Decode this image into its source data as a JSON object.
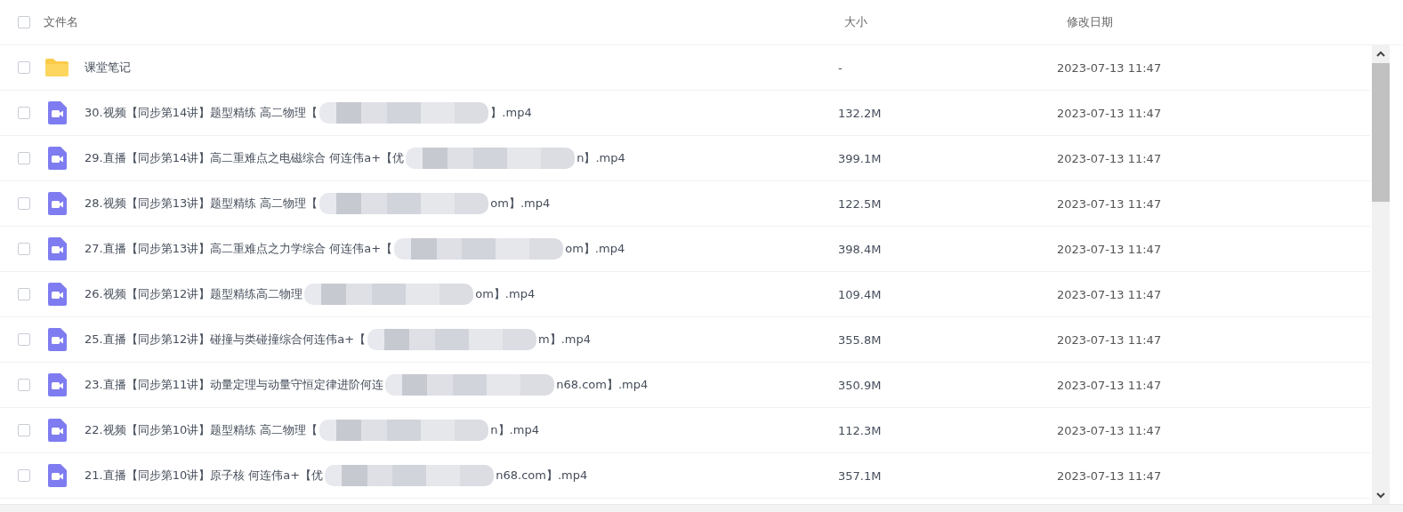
{
  "header": {
    "checked": false,
    "columns": [
      "文件名",
      "大小",
      "修改日期"
    ]
  },
  "rows": [
    {
      "kind": "folder",
      "checked": false,
      "name": "课堂笔记",
      "size": "-",
      "modified": "2023-07-13 11:47"
    },
    {
      "kind": "video",
      "checked": false,
      "name": "30.视频【同步第14讲】题型精练 高二物理【",
      "name_end": "】.mp4",
      "size": "132.2M",
      "modified": "2023-07-13 11:47"
    },
    {
      "kind": "video",
      "checked": false,
      "name": "29.直播【同步第14讲】高二重难点之电磁综合 何连伟a+【优",
      "name_end": "n】.mp4",
      "size": "399.1M",
      "modified": "2023-07-13 11:47"
    },
    {
      "kind": "video",
      "checked": false,
      "name": "28.视频【同步第13讲】题型精练 高二物理【",
      "name_end": "om】.mp4",
      "size": "122.5M",
      "modified": "2023-07-13 11:47"
    },
    {
      "kind": "video",
      "checked": false,
      "name": "27.直播【同步第13讲】高二重难点之力学综合 何连伟a+【",
      "name_end": "om】.mp4",
      "size": "398.4M",
      "modified": "2023-07-13 11:47"
    },
    {
      "kind": "video",
      "checked": false,
      "name": "26.视频【同步第12讲】题型精练高二物理",
      "name_end": "om】.mp4",
      "size": "109.4M",
      "modified": "2023-07-13 11:47"
    },
    {
      "kind": "video",
      "checked": false,
      "name": "25.直播【同步第12讲】碰撞与类碰撞综合何连伟a+【",
      "name_end": "m】.mp4",
      "size": "355.8M",
      "modified": "2023-07-13 11:47"
    },
    {
      "kind": "video",
      "checked": false,
      "name": "23.直播【同步第11讲】动量定理与动量守恒定律进阶何连",
      "name_end": "n68.com】.mp4",
      "size": "350.9M",
      "modified": "2023-07-13 11:47"
    },
    {
      "kind": "video",
      "checked": false,
      "name": "22.视频【同步第10讲】题型精练 高二物理【",
      "name_end": "n】.mp4",
      "size": "112.3M",
      "modified": "2023-07-13 11:47"
    },
    {
      "kind": "video",
      "checked": false,
      "name": "21.直播【同步第10讲】原子核 何连伟a+【优",
      "name_end": "n68.com】.mp4",
      "size": "357.1M",
      "modified": "2023-07-13 11:47"
    }
  ]
}
